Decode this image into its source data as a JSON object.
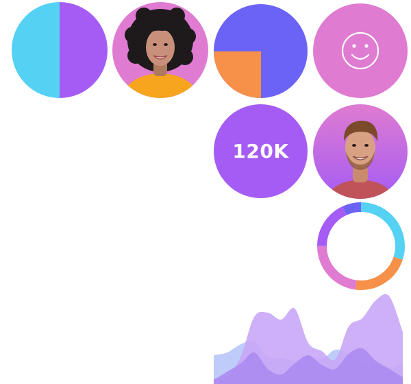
{
  "colors": {
    "cyan": "#55d1f4",
    "purple": "#a55cf4",
    "blue": "#6b63f5",
    "orange": "#f7914a",
    "pink": "#df7bd1",
    "light_purple": "#c8a7f6"
  },
  "tiles": {
    "split_circle": {
      "left_color": "#55d1f4",
      "right_color": "#a55cf4"
    },
    "avatar_woman": {
      "background": "#df7bd1",
      "shirt": "#f7a51f"
    },
    "quarter_circle": {
      "base": "#6b63f5",
      "quarter": "#f7914a"
    },
    "smiley": {
      "background": "#df7bd1",
      "icon": "smile-icon"
    },
    "stat": {
      "value": "120K",
      "background": "#a55cf4"
    },
    "avatar_man": {
      "background_top": "#df7bd1",
      "background_bottom": "#a55cf4",
      "shirt": "#c0525a"
    }
  },
  "donut": {
    "segments": [
      {
        "color": "#55d1f4",
        "fraction": 0.3
      },
      {
        "color": "#f7914a",
        "fraction": 0.22
      },
      {
        "color": "#df7bd1",
        "fraction": 0.23
      },
      {
        "color": "#a55cf4",
        "fraction": 0.18
      },
      {
        "color": "#6b63f5",
        "fraction": 0.07
      }
    ]
  },
  "area_chart": {
    "series": [
      {
        "color": "#b8c6f9",
        "values": [
          42,
          46,
          58,
          62,
          40,
          38,
          34,
          40,
          36,
          50,
          44,
          30,
          26,
          24,
          30
        ]
      },
      {
        "color": "#c8a7f6",
        "values": [
          8,
          12,
          40,
          98,
          104,
          94,
          110,
          60,
          48,
          36,
          84,
          96,
          122,
          128,
          76
        ]
      },
      {
        "color": "#a98af0",
        "values": [
          6,
          18,
          30,
          46,
          22,
          14,
          30,
          42,
          28,
          22,
          44,
          52,
          34,
          22,
          10
        ]
      }
    ]
  }
}
